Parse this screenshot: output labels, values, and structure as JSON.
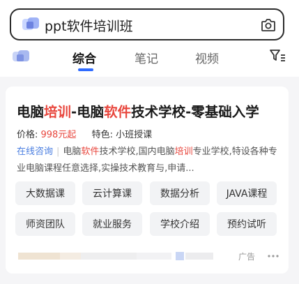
{
  "search": {
    "query": "ppt软件培训班",
    "logo_icon": "app-logo-icon",
    "camera_icon": "camera-icon"
  },
  "tabs": [
    {
      "label": "综合",
      "active": true
    },
    {
      "label": "笔记",
      "active": false
    },
    {
      "label": "视频",
      "active": false
    }
  ],
  "filter_icon": "filter-icon",
  "ad": {
    "title_parts": [
      {
        "text": "电脑",
        "highlight": false
      },
      {
        "text": "培训",
        "highlight": true
      },
      {
        "text": "-电脑",
        "highlight": false
      },
      {
        "text": "软件",
        "highlight": true
      },
      {
        "text": "技术学校-零基础入学",
        "highlight": false
      }
    ],
    "price_label": "价格: ",
    "price_value": "998元起",
    "feature_label": "特色: ",
    "feature_value": "小班授课",
    "consult_link": "在线咨询",
    "description_parts": [
      {
        "text": "电脑",
        "highlight": false
      },
      {
        "text": "软件",
        "highlight": true
      },
      {
        "text": "技术学校,国内电脑",
        "highlight": false
      },
      {
        "text": "培训",
        "highlight": true
      },
      {
        "text": "专业学校,特设各种专业电脑课程任意选择,实操技术教育与,申请...",
        "highlight": false
      }
    ],
    "tags": [
      "大数据课",
      "云计算课",
      "数据分析",
      "JAVA课程",
      "师资团队",
      "就业服务",
      "学校介绍",
      "预约试听"
    ],
    "ad_label": "广告",
    "more_icon": "more-dots-icon"
  },
  "colors": {
    "accent_blue": "#2f6bff",
    "highlight_red": "#e8463d",
    "link_blue": "#4a7ee0"
  }
}
